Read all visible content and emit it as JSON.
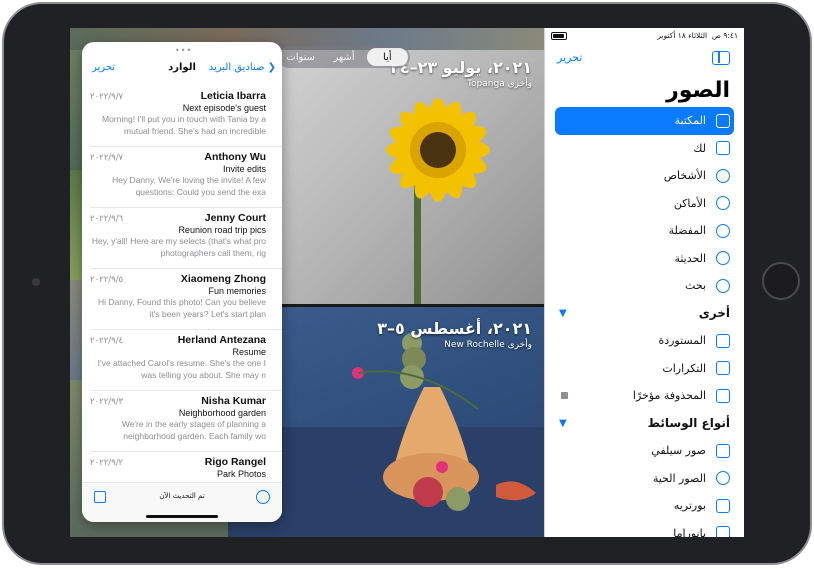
{
  "status_bar": {
    "time": "٩:٤١ ص",
    "date": "الثلاثاء ١٨ أكتوبر"
  },
  "photos": {
    "segments": [
      {
        "label": "سنوات",
        "active": false
      },
      {
        "label": "أشهر",
        "active": false
      },
      {
        "label": "أيا",
        "active": true
      }
    ],
    "photo1": {
      "date": "٢٠٢١، يوليو ٢٣–٢٤",
      "place": "Topanga وأخرى"
    },
    "photo2": {
      "date": "٢٠٢١، أغسطس ٥–٣",
      "place": "New Rochelle وأخرى"
    }
  },
  "sidebar": {
    "edit_label": "تحرير",
    "title": "الصور",
    "items": [
      {
        "label": "المكتبة",
        "icon": "library-icon",
        "active": true
      },
      {
        "label": "لك",
        "icon": "for-you-icon",
        "active": false
      },
      {
        "label": "الأشخاص",
        "icon": "people-icon",
        "active": false
      },
      {
        "label": "الأماكن",
        "icon": "places-icon",
        "active": false
      },
      {
        "label": "المفضلة",
        "icon": "heart-icon",
        "active": false
      },
      {
        "label": "الحديثة",
        "icon": "clock-icon",
        "active": false
      },
      {
        "label": "بحث",
        "icon": "search-icon",
        "active": false
      }
    ],
    "other_section": "أخرى",
    "other_items": [
      {
        "label": "المستوردة",
        "icon": "import-icon"
      },
      {
        "label": "التكرارات",
        "icon": "duplicates-icon"
      },
      {
        "label": "المحذوفة مؤخرًا",
        "icon": "trash-icon"
      }
    ],
    "media_section": "أنواع الوسائط",
    "media_items": [
      {
        "label": "صور سيلفي",
        "icon": "selfie-icon"
      },
      {
        "label": "الصور الحية",
        "icon": "live-photo-icon"
      },
      {
        "label": "بورتريه",
        "icon": "portrait-icon"
      },
      {
        "label": "بانوراما",
        "icon": "panorama-icon"
      }
    ]
  },
  "mail": {
    "back_label": "صناديق البريد",
    "title": "الوارد",
    "edit_label": "تحرير",
    "footer_status": "تم التحديث الآن",
    "messages": [
      {
        "sender": "Leticia Ibarra",
        "date": "٢٠٢٢/٩/٧",
        "subject": "Next episode's guest",
        "preview": "Morning! I'll put you in touch with Tania by a mutual friend. She's had an incredible"
      },
      {
        "sender": "Anthony Wu",
        "date": "٢٠٢٢/٩/٧",
        "subject": "Invite edits",
        "preview": "Hey Danny, We're loving the invite! A few questions: Could you send the exa"
      },
      {
        "sender": "Jenny Court",
        "date": "٢٠٢٢/٩/٦",
        "subject": "Reunion road trip pics",
        "preview": "Hey, y'all! Here are my selects (that's what pro photographers call them, rig"
      },
      {
        "sender": "Xiaomeng Zhong",
        "date": "٢٠٢٢/٩/٥",
        "subject": "Fun memories",
        "preview": "Hi Danny, Found this photo! Can you believe it's been years? Let's start plan"
      },
      {
        "sender": "Herland Antezana",
        "date": "٢٠٢٢/٩/٤",
        "subject": "Resume",
        "preview": "I've attached Carol's resume. She's the one I was telling you about. She may n"
      },
      {
        "sender": "Nisha Kumar",
        "date": "٢٠٢٢/٩/٣",
        "subject": "Neighborhood garden",
        "preview": "We're in the early stages of planning a neighborhood garden. Each family wo"
      },
      {
        "sender": "Rigo Rangel",
        "date": "٢٠٢٢/٩/٢",
        "subject": "Park Photos",
        "preview": ""
      }
    ]
  }
}
